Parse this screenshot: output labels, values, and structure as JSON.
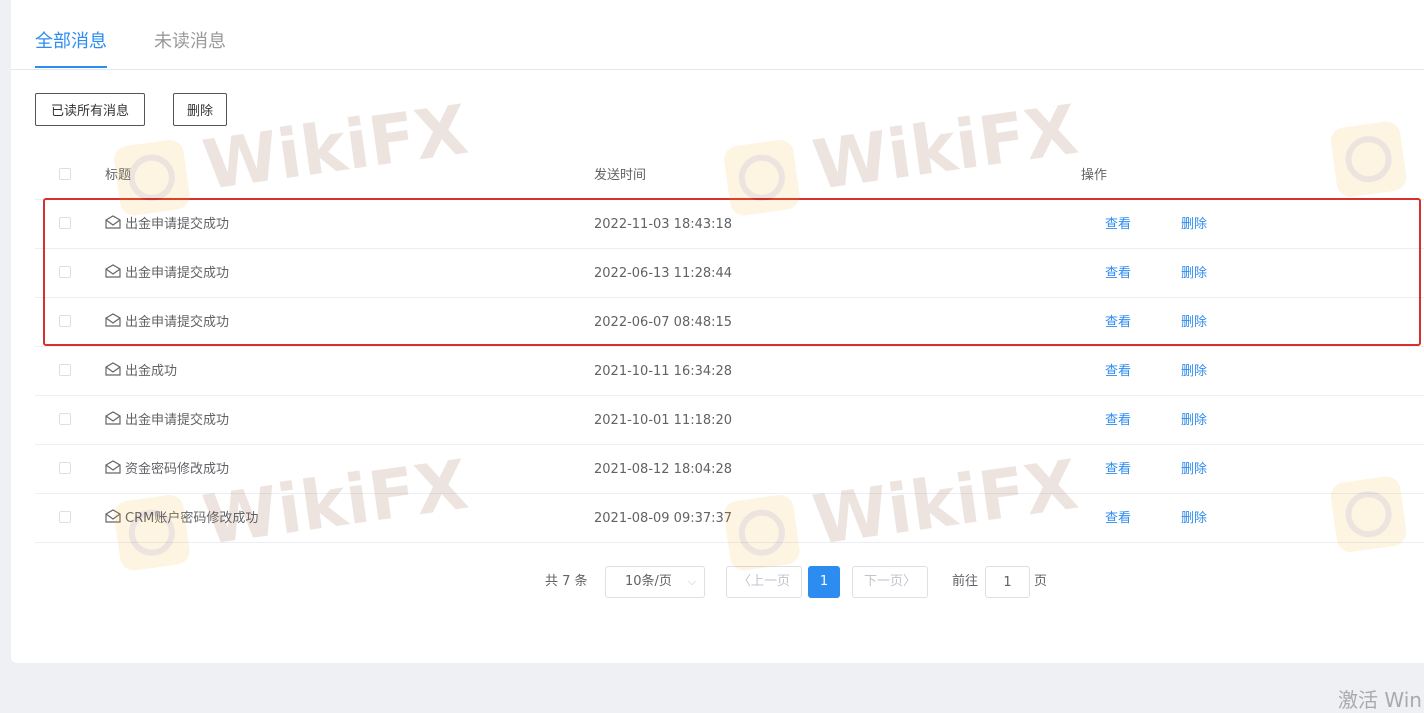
{
  "tabs": {
    "all": "全部消息",
    "unread": "未读消息"
  },
  "toolbar": {
    "mark_all_read": "已读所有消息",
    "delete": "删除"
  },
  "table": {
    "headers": {
      "title": "标题",
      "sent_time": "发送时间",
      "actions": "操作"
    },
    "rows": [
      {
        "title": "出金申请提交成功",
        "time": "2022-11-03 18:43:18",
        "view": "查看",
        "delete": "删除"
      },
      {
        "title": "出金申请提交成功",
        "time": "2022-06-13 11:28:44",
        "view": "查看",
        "delete": "删除"
      },
      {
        "title": "出金申请提交成功",
        "time": "2022-06-07 08:48:15",
        "view": "查看",
        "delete": "删除"
      },
      {
        "title": "出金成功",
        "time": "2021-10-11 16:34:28",
        "view": "查看",
        "delete": "删除"
      },
      {
        "title": "出金申请提交成功",
        "time": "2021-10-01 11:18:20",
        "view": "查看",
        "delete": "删除"
      },
      {
        "title": "资金密码修改成功",
        "time": "2021-08-12 18:04:28",
        "view": "查看",
        "delete": "删除"
      },
      {
        "title": "CRM账户密码修改成功",
        "time": "2021-08-09 09:37:37",
        "view": "查看",
        "delete": "删除"
      }
    ]
  },
  "pagination": {
    "total": "共 7 条",
    "page_size": "10条/页",
    "prev": "上一页",
    "current_page": "1",
    "next": "下一页",
    "goto_label": "前往",
    "goto_value": "1",
    "page_unit": "页"
  },
  "watermark": {
    "text": "WikiFX"
  },
  "os_overlay": {
    "text": "激活 Win"
  },
  "colors": {
    "accent": "#2d8cf0",
    "highlight_box": "#d9302e"
  }
}
